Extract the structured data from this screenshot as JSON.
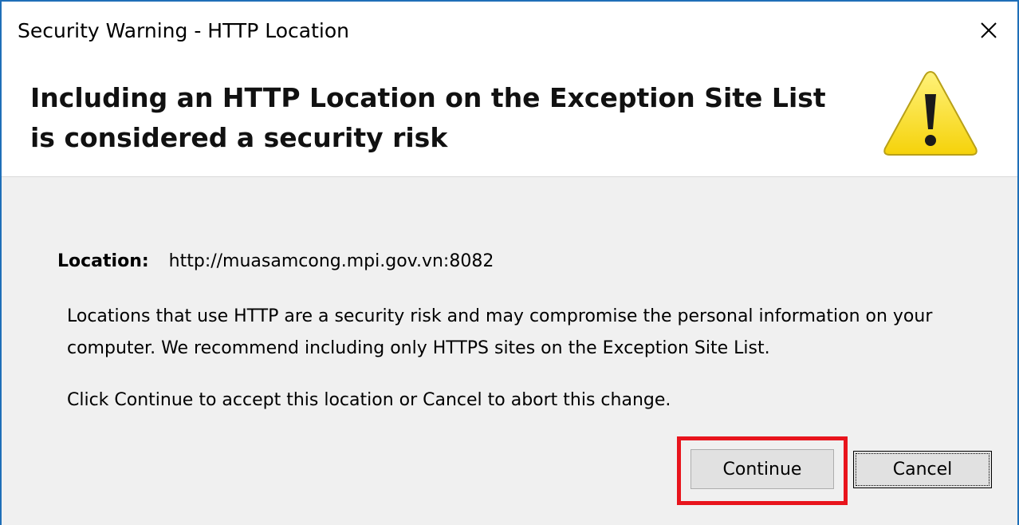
{
  "window": {
    "title": "Security Warning - HTTP Location",
    "close_icon": "close-icon"
  },
  "header": {
    "headline": "Including an HTTP Location on the Exception Site List is considered a security risk",
    "icon": "warning-icon",
    "icon_color": "#f5d20a"
  },
  "body": {
    "location_label": "Location:",
    "location_value": "http://muasamcong.mpi.gov.vn:8082",
    "paragraph1": "Locations that use HTTP are a security risk and may compromise the personal information on your computer.  We recommend including only HTTPS sites on the Exception Site List.",
    "paragraph2": "Click Continue to accept this location or Cancel to abort this change."
  },
  "buttons": {
    "continue_label": "Continue",
    "cancel_label": "Cancel"
  },
  "colors": {
    "window_border": "#1f6fb8",
    "highlight": "#e8141c",
    "background": "#f0f0f0"
  }
}
